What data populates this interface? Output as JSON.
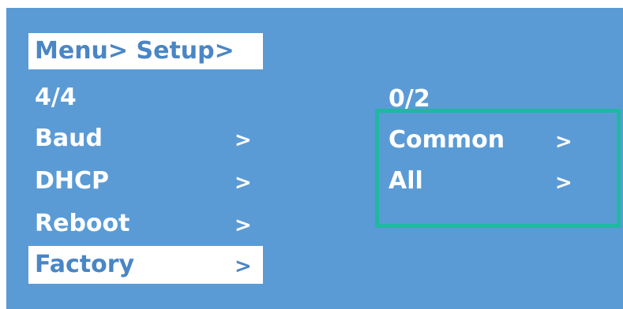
{
  "breadcrumb": "Menu> Setup>",
  "left_panel": {
    "page_indicator": "4/4",
    "items": [
      {
        "label": "Baud",
        "arrow": ">"
      },
      {
        "label": "DHCP",
        "arrow": ">"
      },
      {
        "label": "Reboot",
        "arrow": ">"
      },
      {
        "label": "Factory",
        "arrow": ">"
      }
    ],
    "selected_index": 3
  },
  "right_panel": {
    "page_indicator": "0/2",
    "items": [
      {
        "label": "Common",
        "arrow": ">"
      },
      {
        "label": "All",
        "arrow": ">"
      }
    ]
  },
  "colors": {
    "screen_background": "#5b9bd5",
    "text": "#ffffff",
    "selected_text": "#4a86c5",
    "highlight_border": "#1fb8a0"
  }
}
